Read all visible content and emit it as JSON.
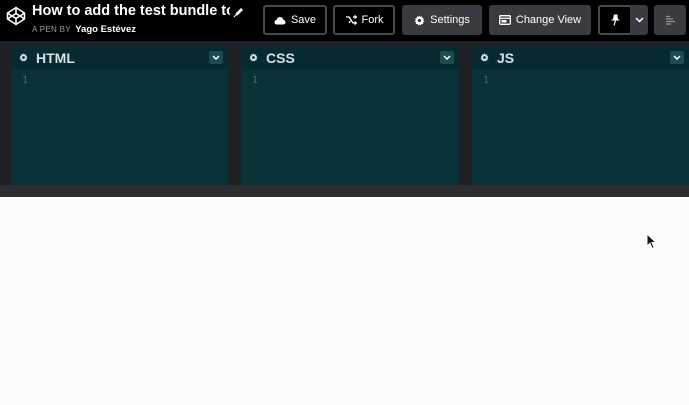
{
  "header": {
    "title": "How to add the test bundle to y...",
    "byline_prefix": "A PEN BY",
    "author": "Yago Estévez"
  },
  "toolbar": {
    "save_label": "Save",
    "fork_label": "Fork",
    "settings_label": "Settings",
    "change_view_label": "Change View"
  },
  "editors": [
    {
      "name": "HTML",
      "line": "1"
    },
    {
      "name": "CSS",
      "line": "1"
    },
    {
      "name": "JS",
      "line": "1"
    }
  ],
  "colors": {
    "header_bg": "#010101",
    "editor_bg": "#093138",
    "preview_bg": "#fdfcfa"
  }
}
